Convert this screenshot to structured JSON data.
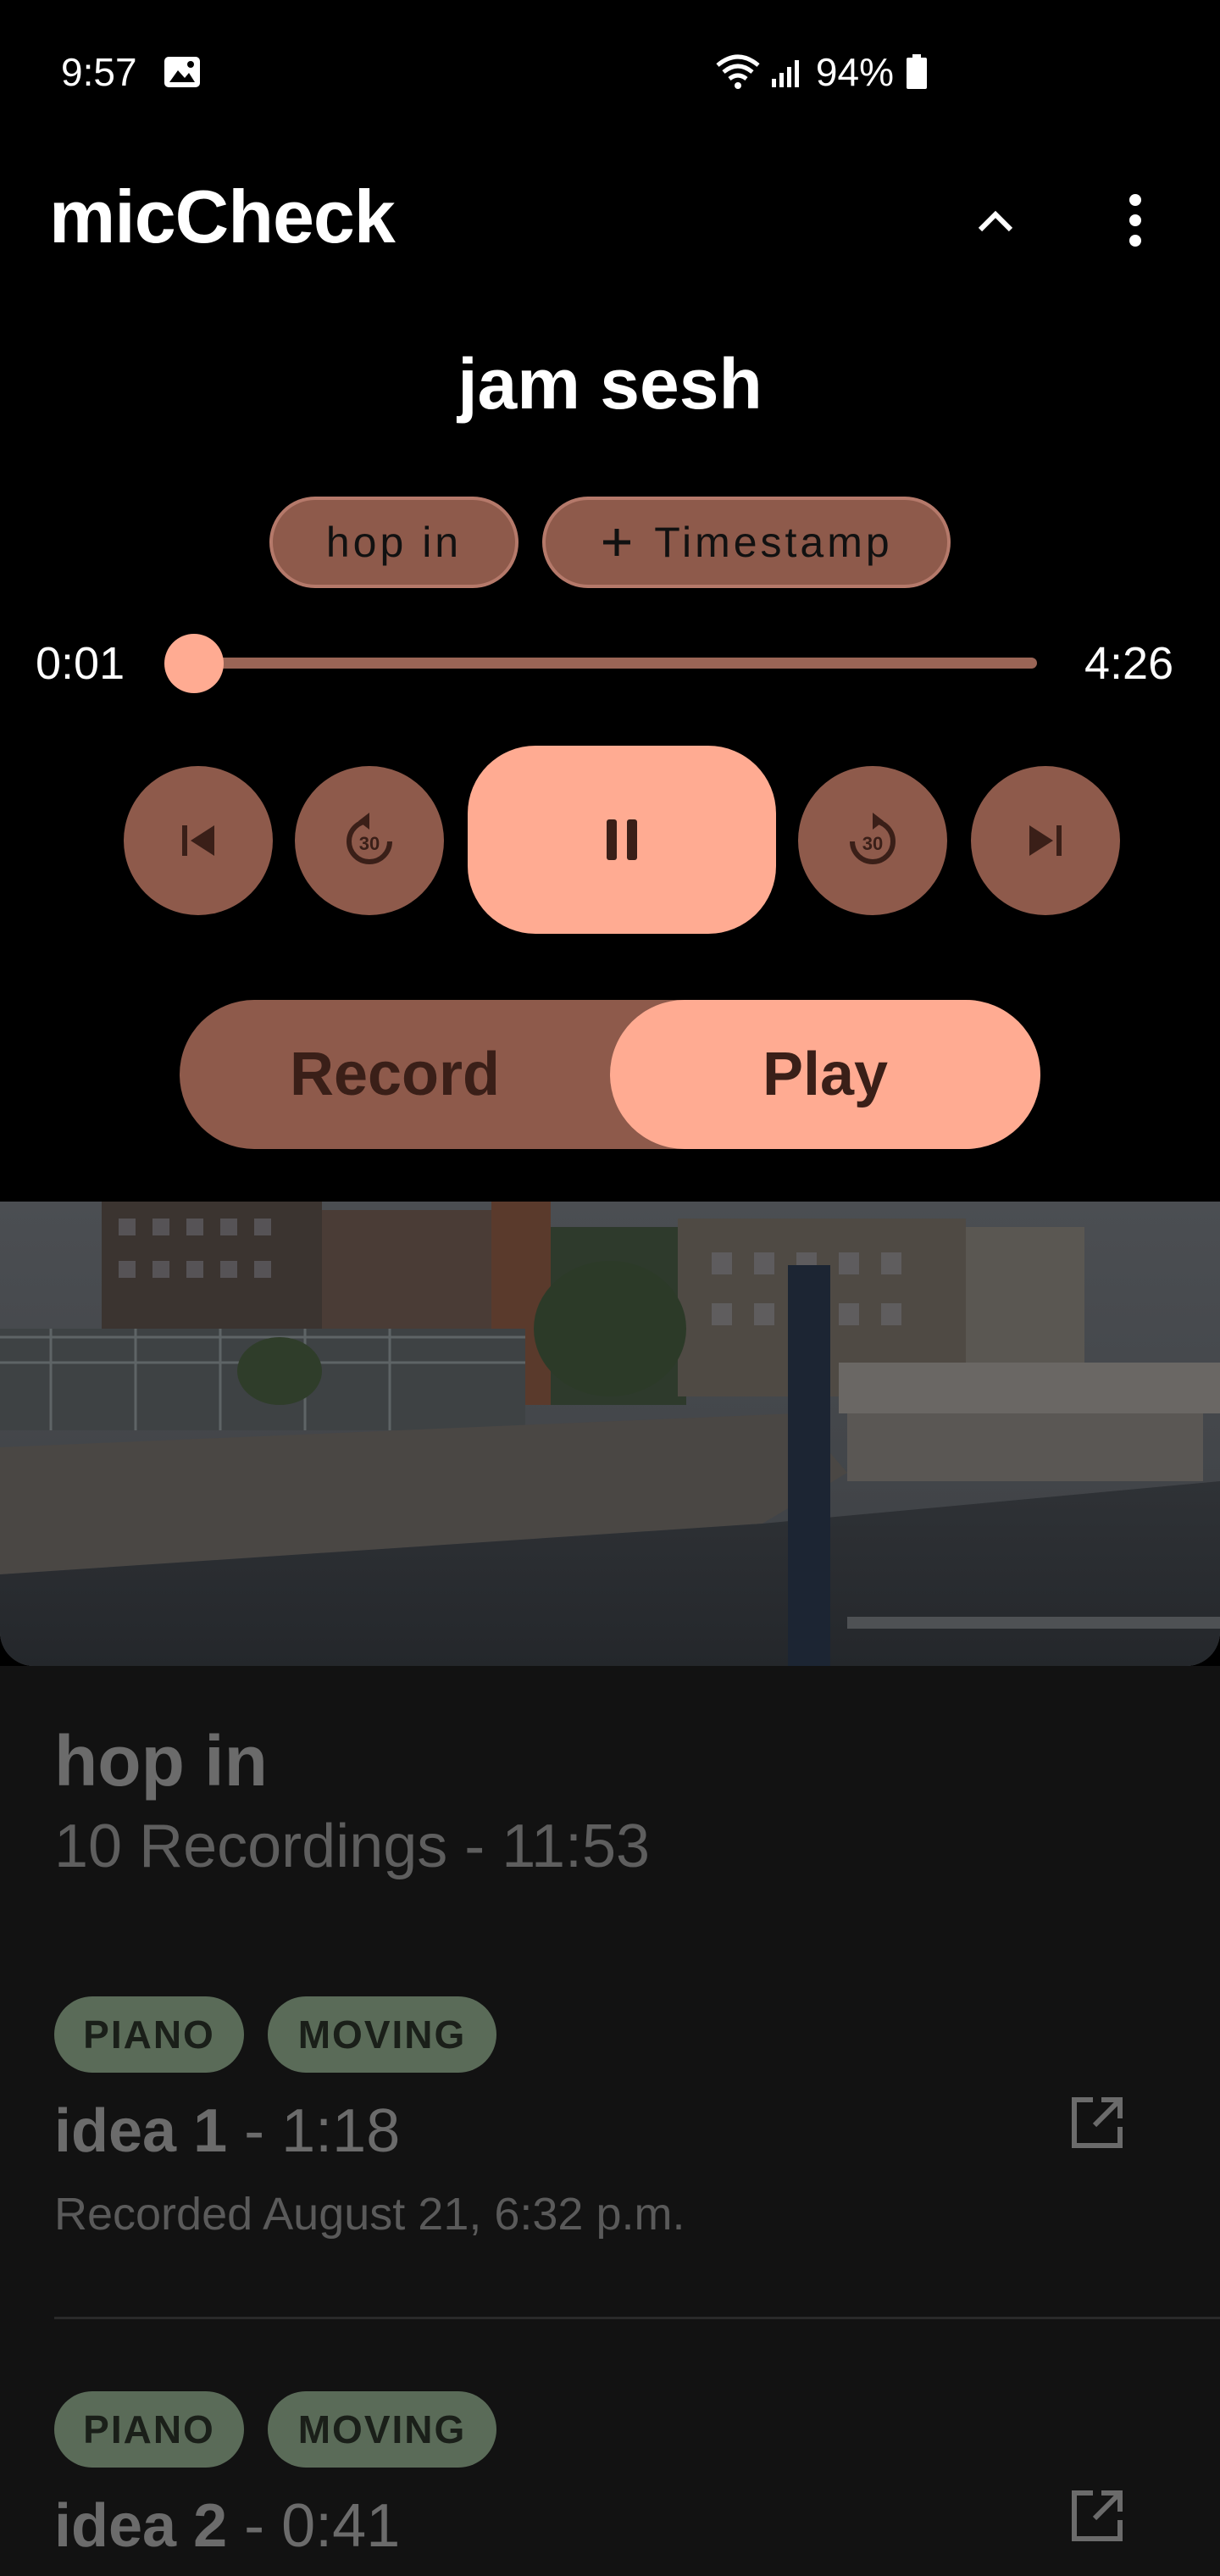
{
  "status": {
    "time": "9:57",
    "battery": "94%"
  },
  "app": {
    "title": "micCheck"
  },
  "player": {
    "song_title": "jam sesh",
    "section_chip": "hop in",
    "timestamp_chip": "Timestamp",
    "current_time": "0:01",
    "total_time": "4:26",
    "progress": 0.004,
    "skip_label": "30"
  },
  "mode_toggle": {
    "record_label": "Record",
    "play_label": "Play",
    "selected": "Play"
  },
  "section": {
    "title": "hop in",
    "summary": "10 Recordings - 11:53"
  },
  "recordings": [
    {
      "tags": [
        "PIANO",
        "MOVING"
      ],
      "name": "idea 1",
      "duration": "1:18",
      "recorded": "Recorded August 21, 6:32 p.m."
    },
    {
      "tags": [
        "PIANO",
        "MOVING"
      ],
      "name": "idea 2",
      "duration": "0:41"
    }
  ],
  "colors": {
    "accent": "#ffab92",
    "accent_dark": "#8e5a4b",
    "tag_bg": "#5a6b58",
    "list_bg": "#121212"
  },
  "icons": [
    "gallery-icon",
    "wifi-icon",
    "signal-icon",
    "battery-icon",
    "chevron-up-icon",
    "more-vert-icon",
    "plus-icon",
    "skip-previous-icon",
    "replay-30-icon",
    "pause-icon",
    "forward-30-icon",
    "skip-next-icon",
    "open-external-icon"
  ]
}
